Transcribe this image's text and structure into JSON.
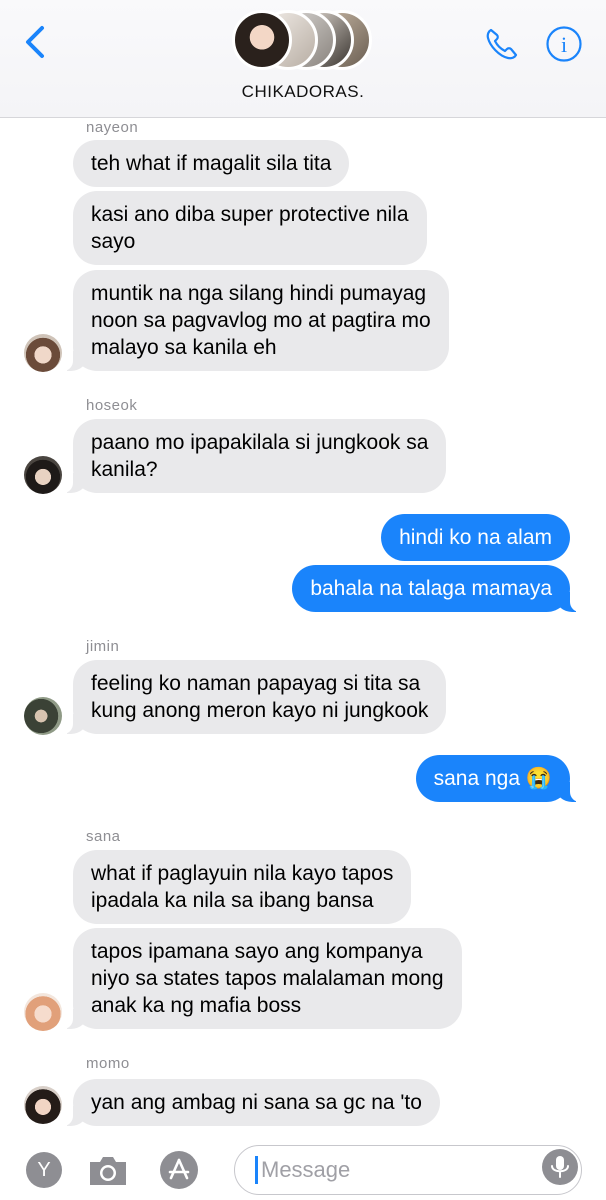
{
  "header": {
    "group_name": "CHIKADORAS."
  },
  "messages": [
    {
      "sender": "nayeon",
      "text": "teh what if magalit sila tita"
    },
    {
      "text": "kasi ano diba super protective nila\nsayo"
    },
    {
      "text": "muntik na nga silang hindi pumayag\nnoon sa pagvavlog mo at pagtira mo\nmalayo sa kanila eh"
    },
    {
      "sender": "hoseok",
      "text": "paano mo ipapakilala si jungkook sa\nkanila?"
    },
    {
      "text": "hindi ko na alam",
      "outgoing": true
    },
    {
      "text": "bahala na talaga mamaya",
      "outgoing": true
    },
    {
      "sender": "jimin",
      "text": "feeling ko naman papayag si tita sa\nkung anong meron kayo ni jungkook"
    },
    {
      "text": "sana nga 😭",
      "outgoing": true
    },
    {
      "sender": "sana",
      "text": "what if paglayuin nila kayo tapos\nipadala ka nila sa ibang bansa"
    },
    {
      "text": "tapos ipamana sayo ang kompanya\nniyo sa states tapos malalaman mong\nanak ka ng mafia boss"
    },
    {
      "sender": "momo",
      "text": "yan ang ambag ni sana sa gc na 'to"
    }
  ],
  "input": {
    "placeholder": "Message",
    "profile_initial": "Y"
  },
  "colors": {
    "outgoing_bubble": "#1a84fb",
    "incoming_bubble": "#e9e9eb",
    "accent": "#1a84fb"
  },
  "icons": [
    "back-chevron-icon",
    "phone-icon",
    "info-icon",
    "camera-icon",
    "app-store-icon",
    "microphone-icon"
  ]
}
